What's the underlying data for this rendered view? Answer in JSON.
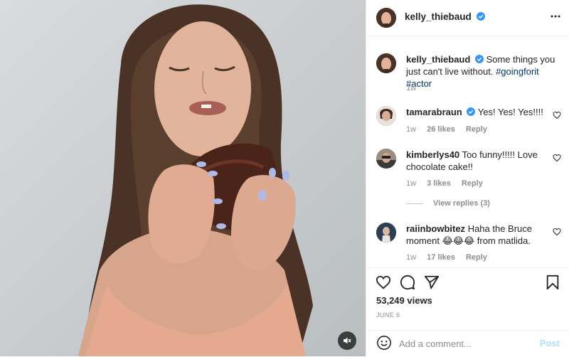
{
  "post": {
    "author": "kelly_thiebaud",
    "caption_text": "Some things you just can't live without.",
    "hashtags": [
      "#goingforit",
      "#actor"
    ],
    "caption_time": "1w"
  },
  "comments": [
    {
      "username": "tamarabraun",
      "verified": true,
      "text": "Yes! Yes! Yes!!!!",
      "time": "1w",
      "likes": "26 likes",
      "reply": "Reply"
    },
    {
      "username": "kimberlys40",
      "verified": false,
      "text": "Too funny!!!!! Love chocolate cake!!",
      "time": "1w",
      "likes": "3 likes",
      "reply": "Reply",
      "view_replies": "View replies (3)"
    },
    {
      "username": "raiinbowbitez",
      "verified": false,
      "text_before": "Haha the Bruce moment",
      "emojis": "😂😂😂",
      "text_after": "from matlida.",
      "time": "1w",
      "likes": "17 likes",
      "reply": "Reply"
    }
  ],
  "stats": {
    "views": "53,249 views",
    "date": "JUNE 6"
  },
  "compose": {
    "placeholder": "Add a comment...",
    "post_label": "Post"
  },
  "icons": {
    "verified": "verified-badge-icon",
    "more": "more-options-icon",
    "like": "heart-icon",
    "comment": "comment-icon",
    "share": "paper-plane-icon",
    "save": "bookmark-icon",
    "emoji": "emoji-icon",
    "mute": "speaker-muted-icon"
  },
  "colors": {
    "verified_blue": "#3897f0",
    "hashtag": "#00376b",
    "muted_text": "#8e8e8e",
    "post_disabled": "#b2dffc"
  }
}
